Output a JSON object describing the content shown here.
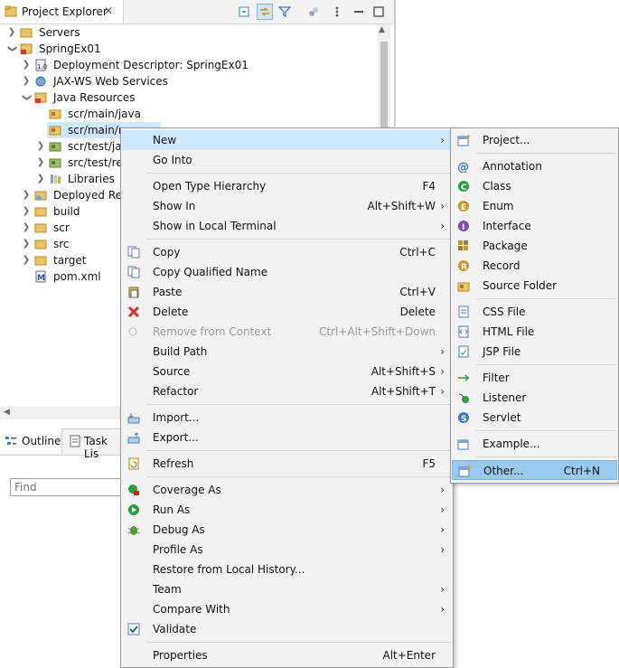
{
  "explorer": {
    "tab_label": "Project Explorer",
    "tree": [
      {
        "label": "Servers"
      },
      {
        "label": "SpringEx01"
      },
      {
        "label": "Deployment Descriptor: SpringEx01"
      },
      {
        "label": "JAX-WS Web Services"
      },
      {
        "label": "Java Resources"
      },
      {
        "label": "scr/main/java"
      },
      {
        "label": "scr/main/re"
      },
      {
        "label": "scr/test/jav"
      },
      {
        "label": "src/test/res"
      },
      {
        "label": "Libraries"
      },
      {
        "label": "Deployed Res"
      },
      {
        "label": "build"
      },
      {
        "label": "scr"
      },
      {
        "label": "src"
      },
      {
        "label": "target"
      },
      {
        "label": "pom.xml"
      }
    ]
  },
  "outline": {
    "tab_label": "Outline",
    "task_tab_label": "Task Lis",
    "find_placeholder": "Find"
  },
  "context_menu": [
    {
      "label": "New",
      "shortcut": ""
    },
    {
      "label": "Go Into",
      "shortcut": ""
    },
    {
      "label": "Open Type Hierarchy",
      "shortcut": "F4"
    },
    {
      "label": "Show In",
      "shortcut": "Alt+Shift+W"
    },
    {
      "label": "Show in Local Terminal",
      "shortcut": ""
    },
    {
      "label": "Copy",
      "shortcut": "Ctrl+C"
    },
    {
      "label": "Copy Qualified Name",
      "shortcut": ""
    },
    {
      "label": "Paste",
      "shortcut": "Ctrl+V"
    },
    {
      "label": "Delete",
      "shortcut": "Delete"
    },
    {
      "label": "Remove from Context",
      "shortcut": "Ctrl+Alt+Shift+Down"
    },
    {
      "label": "Build Path",
      "shortcut": ""
    },
    {
      "label": "Source",
      "shortcut": "Alt+Shift+S"
    },
    {
      "label": "Refactor",
      "shortcut": "Alt+Shift+T"
    },
    {
      "label": "Import...",
      "shortcut": ""
    },
    {
      "label": "Export...",
      "shortcut": ""
    },
    {
      "label": "Refresh",
      "shortcut": "F5"
    },
    {
      "label": "Coverage As",
      "shortcut": ""
    },
    {
      "label": "Run As",
      "shortcut": ""
    },
    {
      "label": "Debug As",
      "shortcut": ""
    },
    {
      "label": "Profile As",
      "shortcut": ""
    },
    {
      "label": "Restore from Local History...",
      "shortcut": ""
    },
    {
      "label": "Team",
      "shortcut": ""
    },
    {
      "label": "Compare With",
      "shortcut": ""
    },
    {
      "label": "Validate",
      "shortcut": ""
    },
    {
      "label": "Properties",
      "shortcut": "Alt+Enter"
    }
  ],
  "submenu_new": [
    {
      "label": "Project...",
      "shortcut": ""
    },
    {
      "label": "Annotation",
      "shortcut": ""
    },
    {
      "label": "Class",
      "shortcut": ""
    },
    {
      "label": "Enum",
      "shortcut": ""
    },
    {
      "label": "Interface",
      "shortcut": ""
    },
    {
      "label": "Package",
      "shortcut": ""
    },
    {
      "label": "Record",
      "shortcut": ""
    },
    {
      "label": "Source Folder",
      "shortcut": ""
    },
    {
      "label": "CSS File",
      "shortcut": ""
    },
    {
      "label": "HTML File",
      "shortcut": ""
    },
    {
      "label": "JSP File",
      "shortcut": ""
    },
    {
      "label": "Filter",
      "shortcut": ""
    },
    {
      "label": "Listener",
      "shortcut": ""
    },
    {
      "label": "Servlet",
      "shortcut": ""
    },
    {
      "label": "Example...",
      "shortcut": ""
    },
    {
      "label": "Other...",
      "shortcut": "Ctrl+N"
    }
  ],
  "colors": {
    "highlight": "#cde8ff",
    "selected": "#99c9ef",
    "menu_bg": "#f2f2f2"
  }
}
